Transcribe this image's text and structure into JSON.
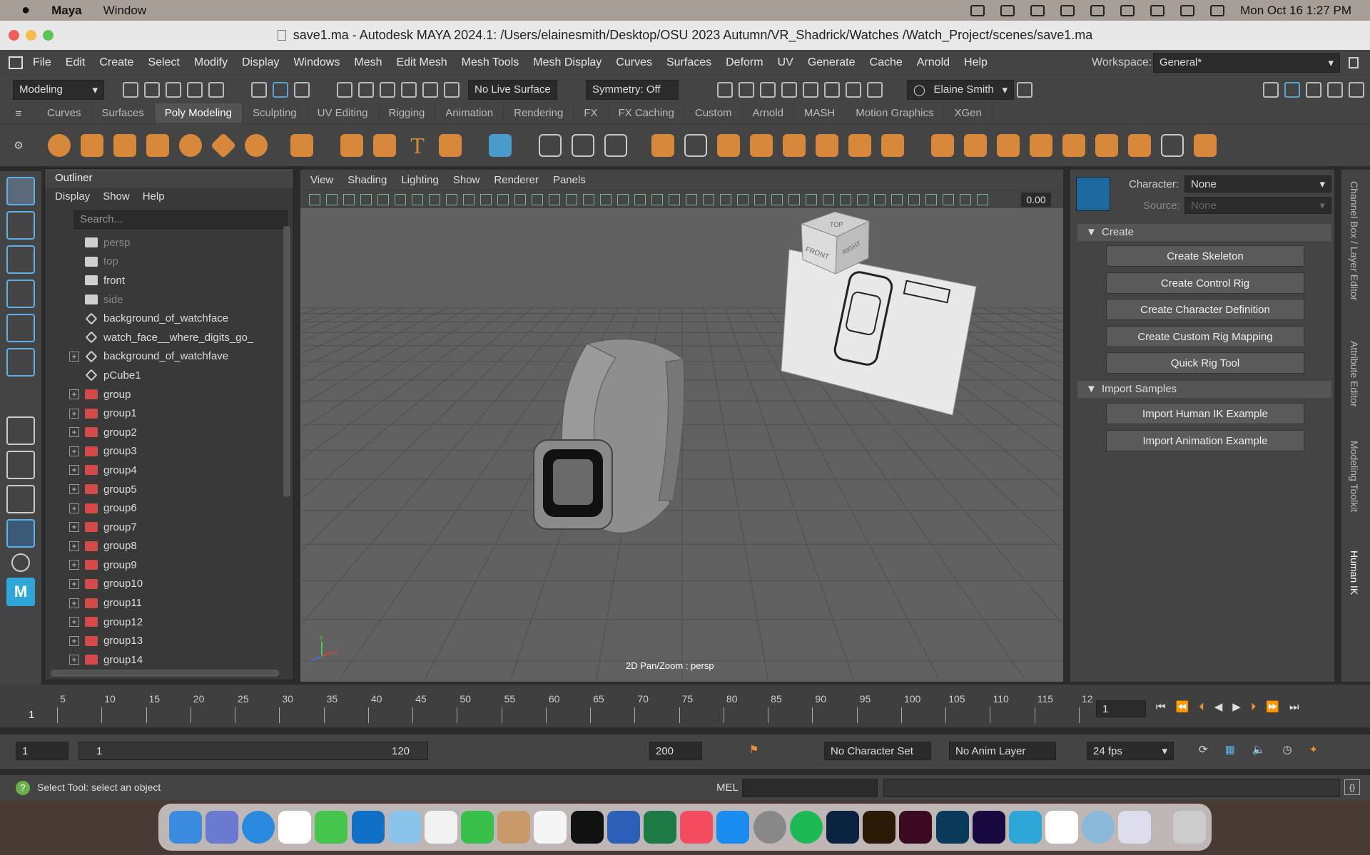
{
  "mac_menu": {
    "app": "Maya",
    "items": [
      "Window"
    ],
    "clock": "Mon Oct 16  1:27 PM"
  },
  "window": {
    "title": "save1.ma - Autodesk MAYA 2024.1: /Users/elainesmith/Desktop/OSU 2023 Autumn/VR_Shadrick/Watches /Watch_Project/scenes/save1.ma"
  },
  "menus": [
    "File",
    "Edit",
    "Create",
    "Select",
    "Modify",
    "Display",
    "Windows",
    "Mesh",
    "Edit Mesh",
    "Mesh Tools",
    "Mesh Display",
    "Curves",
    "Surfaces",
    "Deform",
    "UV",
    "Generate",
    "Cache",
    "Arnold",
    "Help"
  ],
  "workspace": {
    "label": "Workspace:",
    "value": "General*"
  },
  "toolbar": {
    "mode": "Modeling",
    "live_surface": "No Live Surface",
    "symmetry": "Symmetry: Off",
    "user": "Elaine Smith"
  },
  "shelf_tabs": [
    "Curves",
    "Surfaces",
    "Poly Modeling",
    "Sculpting",
    "UV Editing",
    "Rigging",
    "Animation",
    "Rendering",
    "FX",
    "FX Caching",
    "Custom",
    "Arnold",
    "MASH",
    "Motion Graphics",
    "XGen"
  ],
  "shelf_active": "Poly Modeling",
  "outliner": {
    "title": "Outliner",
    "menu": [
      "Display",
      "Show",
      "Help"
    ],
    "search_placeholder": "Search...",
    "items": [
      {
        "name": "persp",
        "type": "camera",
        "dim": true,
        "expand": false
      },
      {
        "name": "top",
        "type": "camera",
        "dim": true,
        "expand": false
      },
      {
        "name": "front",
        "type": "camera",
        "dim": false,
        "expand": false
      },
      {
        "name": "side",
        "type": "camera",
        "dim": true,
        "expand": false
      },
      {
        "name": "background_of_watchface",
        "type": "mesh",
        "dim": false,
        "expand": false
      },
      {
        "name": "watch_face__where_digits_go_",
        "type": "mesh",
        "dim": false,
        "expand": false
      },
      {
        "name": "background_of_watchfave",
        "type": "mesh",
        "dim": false,
        "expand": true
      },
      {
        "name": "pCube1",
        "type": "mesh",
        "dim": false,
        "expand": false
      },
      {
        "name": "group",
        "type": "group",
        "dim": false,
        "expand": true
      },
      {
        "name": "group1",
        "type": "group",
        "dim": false,
        "expand": true
      },
      {
        "name": "group2",
        "type": "group",
        "dim": false,
        "expand": true
      },
      {
        "name": "group3",
        "type": "group",
        "dim": false,
        "expand": true
      },
      {
        "name": "group4",
        "type": "group",
        "dim": false,
        "expand": true
      },
      {
        "name": "group5",
        "type": "group",
        "dim": false,
        "expand": true
      },
      {
        "name": "group6",
        "type": "group",
        "dim": false,
        "expand": true
      },
      {
        "name": "group7",
        "type": "group",
        "dim": false,
        "expand": true
      },
      {
        "name": "group8",
        "type": "group",
        "dim": false,
        "expand": true
      },
      {
        "name": "group9",
        "type": "group",
        "dim": false,
        "expand": true
      },
      {
        "name": "group10",
        "type": "group",
        "dim": false,
        "expand": true
      },
      {
        "name": "group11",
        "type": "group",
        "dim": false,
        "expand": true
      },
      {
        "name": "group12",
        "type": "group",
        "dim": false,
        "expand": true
      },
      {
        "name": "group13",
        "type": "group",
        "dim": false,
        "expand": true
      },
      {
        "name": "group14",
        "type": "group",
        "dim": false,
        "expand": true
      }
    ]
  },
  "viewport": {
    "menu": [
      "View",
      "Shading",
      "Lighting",
      "Show",
      "Renderer",
      "Panels"
    ],
    "value": "0.00",
    "status": "2D Pan/Zoom : persp",
    "cube": {
      "top": "TOP",
      "front": "FRONT",
      "right": "RIGHT"
    },
    "axes": {
      "y": "y",
      "x": "x",
      "z": "z"
    }
  },
  "human_ik": {
    "character_label": "Character:",
    "character": "None",
    "source_label": "Source:",
    "source": "None",
    "create_title": "Create",
    "create_buttons": [
      "Create Skeleton",
      "Create Control Rig",
      "Create Character Definition",
      "Create Custom Rig Mapping",
      "Quick Rig Tool"
    ],
    "import_title": "Import Samples",
    "import_buttons": [
      "Import Human IK Example",
      "Import Animation Example"
    ]
  },
  "side_tabs": [
    "Channel Box / Layer Editor",
    "Attribute Editor",
    "Modeling Toolkit",
    "Human IK"
  ],
  "timeline": {
    "ticks": [
      "5",
      "10",
      "15",
      "20",
      "25",
      "30",
      "35",
      "40",
      "45",
      "50",
      "55",
      "60",
      "65",
      "70",
      "75",
      "80",
      "85",
      "90",
      "95",
      "100",
      "105",
      "110",
      "115",
      "12"
    ],
    "current_frame": "1",
    "frame_field": "1"
  },
  "range": {
    "start": "1",
    "inner_start": "1",
    "inner_end": "120",
    "end": "200",
    "char_set": "No Character Set",
    "anim_layer": "No Anim Layer",
    "fps": "24 fps"
  },
  "command": {
    "help": "Select Tool: select an object",
    "lang": "MEL"
  },
  "colors": {
    "accent": "#e8903a",
    "selection": "#5fb0e6",
    "panel": "#444444",
    "viewport": "#616161"
  }
}
